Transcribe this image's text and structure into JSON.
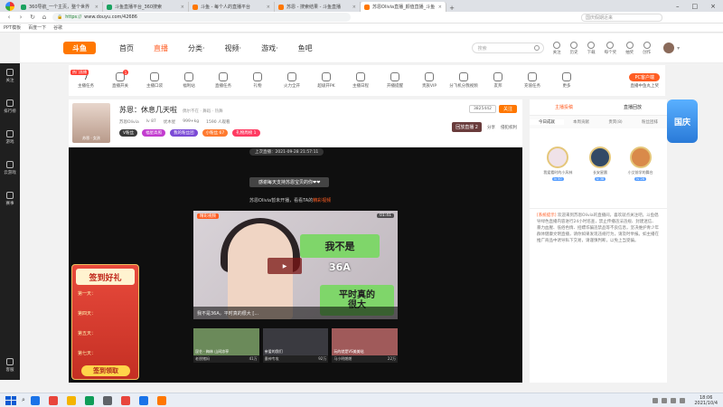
{
  "browser": {
    "tabs": [
      {
        "label": "360导航_一个主页，整个世界",
        "color": "#1aa260",
        "active": false
      },
      {
        "label": "斗鱼直播平台_360搜索",
        "color": "#1aa260",
        "active": false
      },
      {
        "label": "斗鱼 - 每个人的直播平台",
        "color": "#ff7700",
        "active": false
      },
      {
        "label": "苏恩 - 搜索结果 - 斗鱼直播",
        "color": "#ff7700",
        "active": false
      },
      {
        "label": "苏恩Olivia直播_颜值直播_斗鱼",
        "color": "#ff7700",
        "active": true
      }
    ],
    "url_prefix": "https://",
    "url": "www.douyu.com/42686",
    "second_box": "国庆假期近来",
    "bookmarks": [
      "PPT模板",
      "百度一下",
      "谷歌"
    ]
  },
  "leftrail": {
    "items": [
      "关注",
      "排行榜",
      "游戏",
      "云游戏",
      "赛事"
    ],
    "footer": "客服"
  },
  "topnav": {
    "logo": "斗鱼",
    "menu": [
      "首页",
      "直播",
      "分类·",
      "视频·",
      "游戏·",
      "鱼吧"
    ],
    "active_index": 1,
    "search_placeholder": "搜索",
    "icons": [
      "关注",
      "历史",
      "下载",
      "每个奖",
      "抽奖",
      "创作"
    ]
  },
  "toolbar": {
    "new_badge": "热门直播",
    "items": [
      {
        "label": "主播任务",
        "num": "7"
      },
      {
        "label": "直播开关",
        "dot": "1"
      },
      {
        "label": "主播口袋"
      },
      {
        "label": "福利站"
      },
      {
        "label": "直播任务"
      },
      {
        "label": "礼物"
      },
      {
        "label": "火力全开"
      },
      {
        "label": "超级开PK"
      },
      {
        "label": "主播日程"
      },
      {
        "label": "开播提醒"
      },
      {
        "label": "贵族VIP"
      },
      {
        "label": "分飞机分我视频"
      },
      {
        "label": "友邦"
      },
      {
        "label": "充值任务"
      },
      {
        "label": "更多"
      }
    ],
    "pc_button": "PC客户端",
    "pc_sub": "直播中鱼丸上奖"
  },
  "room": {
    "anchor_label": "苏恩 · 女孩",
    "title": "苏恩：休息几天啦",
    "title_sub": "偶尔不在 · 舞蹈 · 热舞",
    "meta": [
      "苏恩Olivia",
      "lv 87",
      "优木星",
      "999+kg",
      "1590 人观看"
    ],
    "tags": [
      {
        "text": "V粉丝",
        "color": "#3a3a3a"
      },
      {
        "text": "福星高照",
        "color": "#c23ccf"
      },
      {
        "text": "我的粉丝团",
        "color": "#7b4ad6"
      },
      {
        "text": "小粉丝 67",
        "color": "#ff7a2f"
      },
      {
        "text": "礼物周榜 1",
        "color": "#ff3b62"
      }
    ],
    "fans": "3825442",
    "follow": "关注",
    "replay": "回放直播 2",
    "share": "分享",
    "report": "侵犯权利"
  },
  "player": {
    "last_live": "上次直播：2021-09-28 21:57:11",
    "notice": "感谢每天支持苏恩宝贝的你❤❤",
    "offline_text": "苏恩Olivia暂未开播，看看TA的",
    "offline_highlight": "精彩视频",
    "video_tag": "精彩视频",
    "video_time": "01:41",
    "caption1": "我不是",
    "caption2": "36A",
    "caption3_line1": "平时真的",
    "caption3_line2": "很大",
    "video_title": "我不是36A，平时真的很大 [...",
    "recs": [
      {
        "caption": "昆仑 · 梅林 山间凉亭",
        "author": "老朋猪妈",
        "views": "41万",
        "color": "#6b8a5a"
      },
      {
        "caption": "亲爱的我们",
        "author": "墨神专攻",
        "views": "92万",
        "color": "#3a3a40"
      },
      {
        "caption": "玩的就是VS美美哒",
        "author": "马小明朗朗",
        "views": "22万",
        "color": "#a05a5a"
      }
    ]
  },
  "promo": {
    "title": "签到好礼",
    "days": [
      "第一天：",
      "第四天：",
      "第五天：",
      "第七天："
    ],
    "button": "签到领取"
  },
  "rpanel": {
    "head": [
      "主播投稿",
      "直播回放"
    ],
    "tabs": [
      "今日成就",
      "本周贡献",
      "贵宾(8)",
      "粉丝团排"
    ],
    "ranks": [
      {
        "name": "我爱看时的小风林",
        "lv": "lv 50",
        "color": "#f0e2e8"
      },
      {
        "name": "长安星晨",
        "lv": "lv 38",
        "color": "#334a66"
      },
      {
        "name": "小艾前学的舞台",
        "lv": "lv 26",
        "color": "#d98a4a"
      }
    ],
    "sys_tag": "[系统提示]",
    "sys_msg": "欢迎来到苏恩Olivia的直播间，喜欢就点关注吧。斗鱼倡导绿色直播内容进行24小时巡查，禁止传播违法违规、封建迷信、暴力血腥、低俗色情、招嫖诈骗违禁品等不良信息，坚决维护青少年群体健康文明直播，请你如果发现违规行为，请及时举报。如主播在推广商品中诱导私下交易，请谨慎判断，以免上当受骗。",
    "mascot": "国庆"
  },
  "taskbar": {
    "icons": [
      "#1a73e8",
      "#e8453c",
      "#f4b400",
      "#0f9d58",
      "#5f6368",
      "#e8453c",
      "#1a73e8",
      "#ff7700"
    ],
    "time": "18:06",
    "date": "2021/10/4"
  }
}
